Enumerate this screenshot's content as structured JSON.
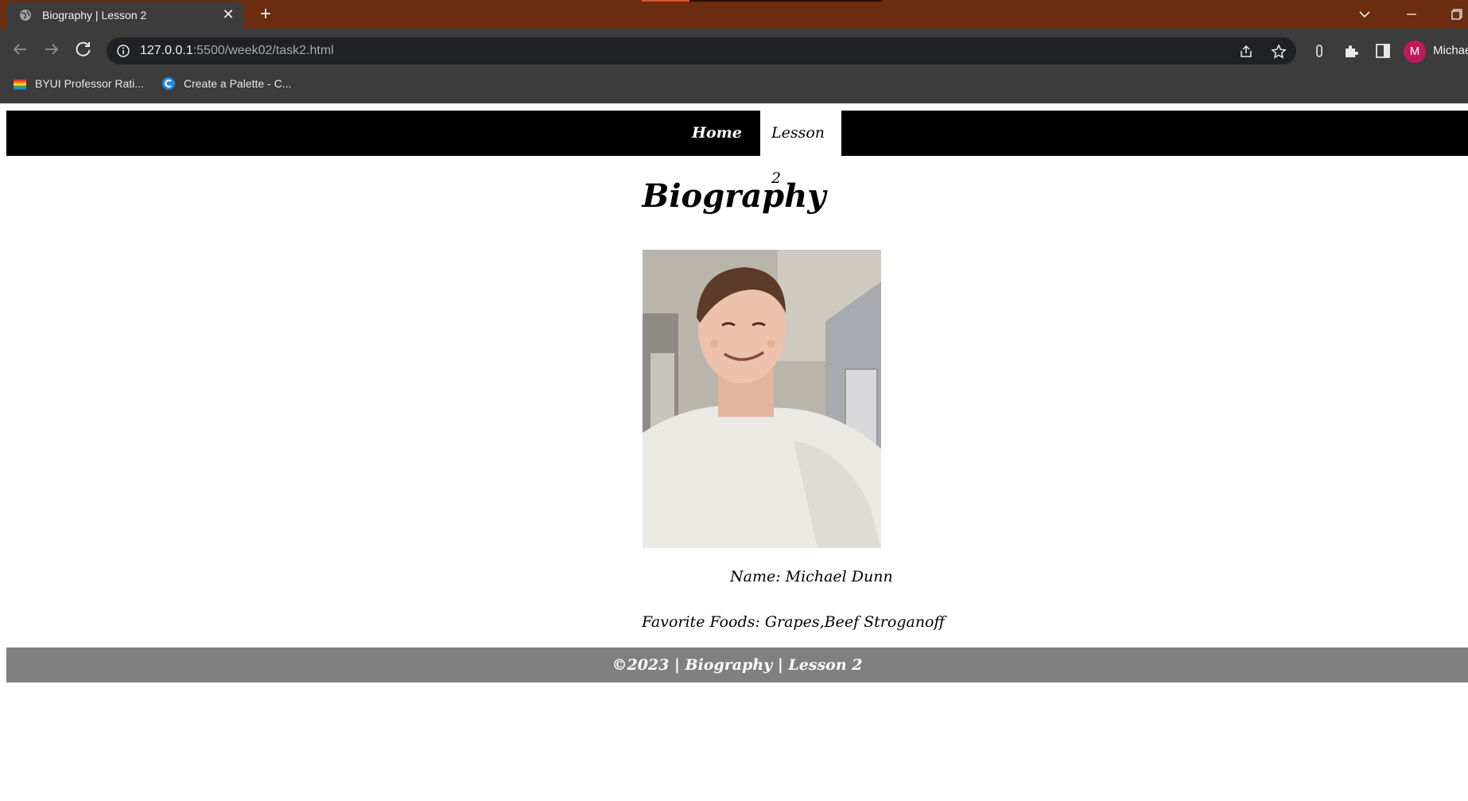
{
  "browser": {
    "tab": {
      "title": "Biography | Lesson 2",
      "favicon": "globe-icon"
    },
    "address": {
      "host": "127.0.0.1",
      "path": ":5500/week02/task2.html"
    },
    "profile": {
      "initial": "M",
      "name": "Michael"
    },
    "bookmarks": [
      {
        "label": "BYUI Professor Rati...",
        "icon": "rainbow-logo-icon"
      },
      {
        "label": "Create a Palette - C...",
        "icon": "coolors-logo-icon"
      }
    ],
    "colors": {
      "tab_strip": "#6b2c0f",
      "toolbar": "#3c3c3c",
      "omnibox": "#202124",
      "avatar": "#c2185b"
    }
  },
  "page": {
    "nav": {
      "home": "Home",
      "active": "Lesson 2"
    },
    "title": "Biography",
    "name_line": "Name: Michael Dunn",
    "foods_line": "Favorite Foods: Grapes,Beef Stroganoff",
    "footer": "©2023 | Biography | Lesson 2",
    "colors": {
      "nav_bg": "#000000",
      "footer_bg": "#808080"
    }
  }
}
